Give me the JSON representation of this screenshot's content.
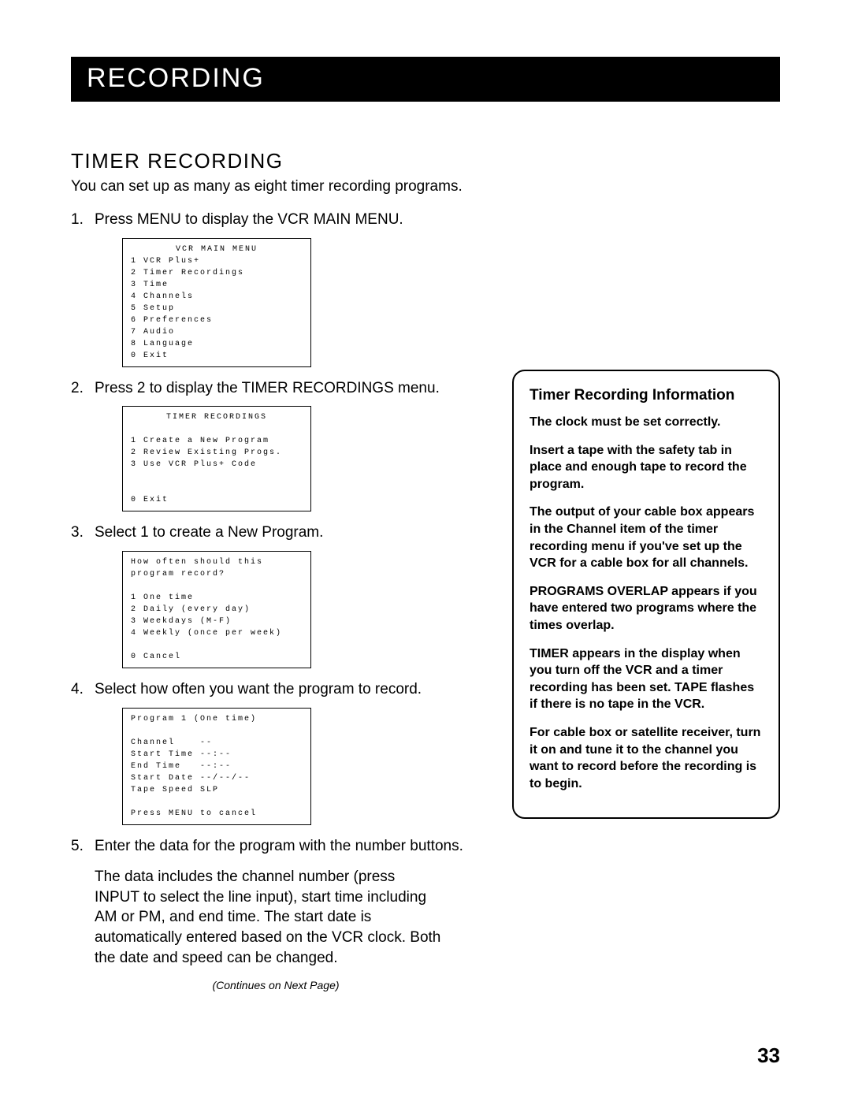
{
  "header": {
    "title": "Recording"
  },
  "section": {
    "title": "Timer Recording"
  },
  "intro": "You can set up as many as eight timer recording programs.",
  "steps": {
    "s1": "Press MENU to display the VCR MAIN MENU.",
    "s2": "Press 2 to display the TIMER RECORDINGS menu.",
    "s3": "Select 1 to create a New Program.",
    "s4": "Select how often you want the program to record.",
    "s5": "Enter the data for the program with the number buttons."
  },
  "step5_detail": "The data includes the channel number (press INPUT to select the line input), start time including AM or PM, and end time. The start date is automatically entered based on the VCR clock. Both the date and speed can be changed.",
  "menus": {
    "main": {
      "title": "VCR MAIN MENU",
      "lines": [
        "1 VCR Plus+",
        "2 Timer Recordings",
        "3 Time",
        "4 Channels",
        "5 Setup",
        "6 Preferences",
        "7 Audio",
        "8 Language",
        "0 Exit"
      ]
    },
    "timer": {
      "title": "TIMER RECORDINGS",
      "lines": [
        "1 Create a New Program",
        "2 Review Existing Progs.",
        "3 Use VCR Plus+ Code",
        "",
        "",
        "0 Exit"
      ]
    },
    "freq": {
      "lines": [
        "How often should this",
        "program record?",
        "",
        "1 One time",
        "2 Daily (every day)",
        "3 Weekdays (M-F)",
        "4 Weekly (once per week)",
        "",
        "0 Cancel"
      ]
    },
    "program": {
      "lines": [
        "Program 1 (One time)",
        "",
        "Channel    --",
        "Start Time --:--",
        "End Time   --:--",
        "Start Date --/--/--",
        "Tape Speed SLP",
        "",
        "Press MENU to cancel"
      ]
    }
  },
  "continues": "(Continues on Next Page)",
  "info_box": {
    "title": "Timer Recording Information",
    "p1": "The clock must be set correctly.",
    "p2": "Insert a tape with the safety tab in place and enough tape to record the program.",
    "p3": "The output of your cable box appears in the Channel item of the timer recording menu if you've set up the VCR for a cable box for all channels.",
    "p4": "PROGRAMS OVERLAP appears if you have entered two programs where the times overlap.",
    "p5": "TIMER appears in the display when you turn off the VCR and a timer recording has been set.  TAPE flashes if there is no tape in the VCR.",
    "p6": "For cable box or satellite receiver, turn it on and tune it to the channel you want to record before the recording is to begin."
  },
  "page_number": "33"
}
